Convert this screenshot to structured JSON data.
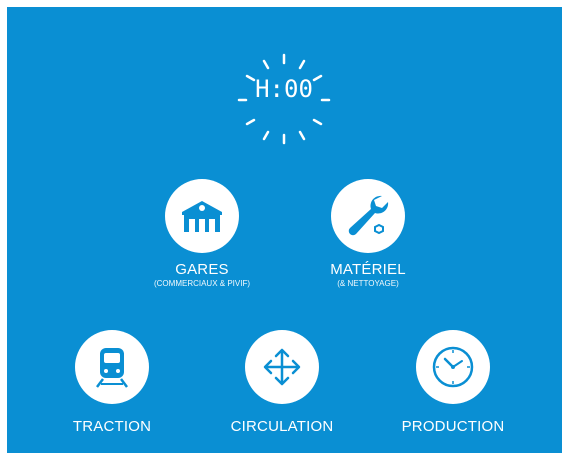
{
  "clock": {
    "time": "H:00"
  },
  "services": [
    {
      "name": "GARES",
      "subtitle": "(COMMERCIAUX & PIVIF)",
      "icon": "station-building-icon"
    },
    {
      "name": "MATÉRIEL",
      "subtitle": "(& NETTOYAGE)",
      "icon": "wrench-icon"
    },
    {
      "name": "TRACTION",
      "subtitle": "",
      "icon": "train-icon"
    },
    {
      "name": "CIRCULATION",
      "subtitle": "",
      "icon": "four-arrows-icon"
    },
    {
      "name": "PRODUCTION",
      "subtitle": "",
      "icon": "clock-icon"
    }
  ],
  "colors": {
    "background": "#0a8fd3",
    "icon_fill": "#0a8fd3",
    "circle": "#ffffff"
  }
}
